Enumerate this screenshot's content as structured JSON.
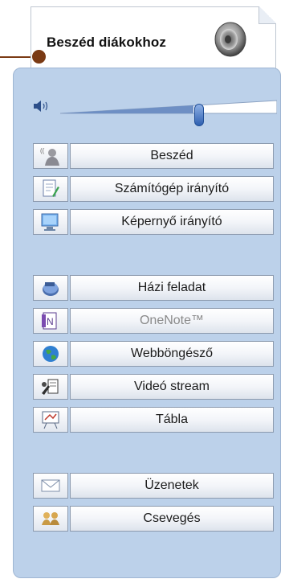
{
  "header": {
    "title": "Beszéd diákokhoz",
    "icon": "speaker-icon"
  },
  "volume": {
    "icon": "volume-icon",
    "level": 0.62
  },
  "groups": [
    {
      "items": [
        {
          "label": "Beszéd",
          "icon": "speech-person-icon",
          "enabled": true
        },
        {
          "label": "Számítógép irányító",
          "icon": "document-pen-icon",
          "enabled": true
        },
        {
          "label": "Képernyő irányító",
          "icon": "monitor-icon",
          "enabled": true
        }
      ]
    },
    {
      "items": [
        {
          "label": "Házi feladat",
          "icon": "homework-icon",
          "enabled": true
        },
        {
          "label": "OneNote™",
          "icon": "onenote-icon",
          "enabled": false
        },
        {
          "label": "Webböngésző",
          "icon": "globe-icon",
          "enabled": true
        },
        {
          "label": "Videó stream",
          "icon": "video-stream-icon",
          "enabled": true
        },
        {
          "label": "Tábla",
          "icon": "whiteboard-icon",
          "enabled": true
        }
      ]
    },
    {
      "items": [
        {
          "label": "Üzenetek",
          "icon": "envelope-icon",
          "enabled": true
        },
        {
          "label": "Csevegés",
          "icon": "chat-people-icon",
          "enabled": true
        }
      ]
    }
  ]
}
